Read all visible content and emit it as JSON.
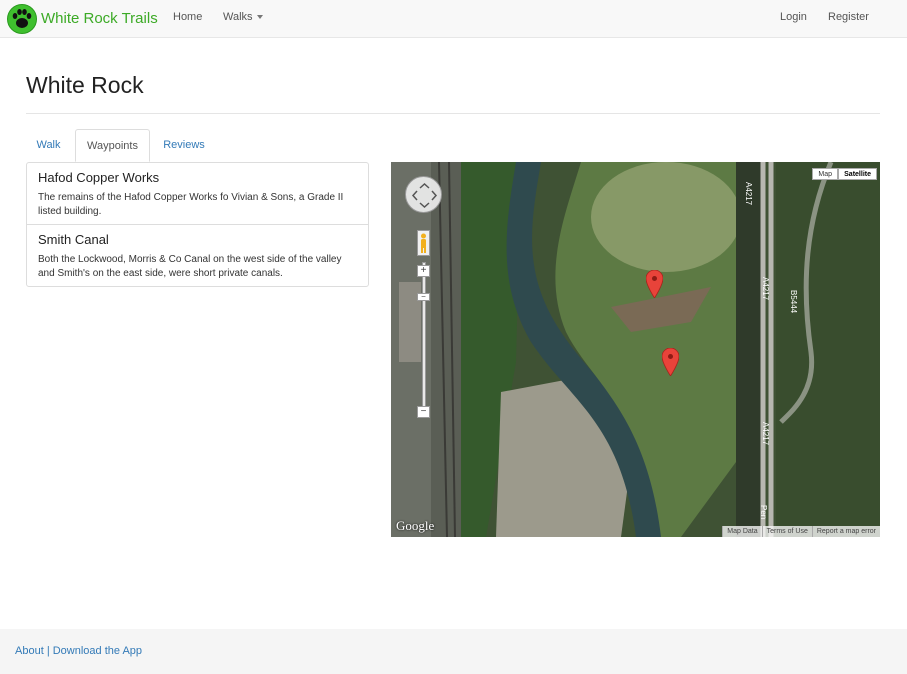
{
  "navbar": {
    "brand": "White Rock Trails",
    "logo_icon": "paw-print-icon",
    "home": "Home",
    "walks": "Walks",
    "login": "Login",
    "register": "Register"
  },
  "page": {
    "title": "White Rock"
  },
  "tabs": [
    {
      "label": "Walk"
    },
    {
      "label": "Waypoints",
      "active": true
    },
    {
      "label": "Reviews"
    }
  ],
  "waypoints": [
    {
      "title": "Hafod Copper Works",
      "description": "The remains of the Hafod Copper Works fo Vivian & Sons, a Grade II listed building."
    },
    {
      "title": "Smith Canal",
      "description": "Both the Lockwood, Morris & Co Canal on the west side of the valley and Smith's on the east side, were short private canals."
    }
  ],
  "map": {
    "type_map": "Map",
    "type_satellite": "Satellite",
    "logo": "Google",
    "map_data": "Map Data",
    "terms": "Terms of Use",
    "report": "Report a map error",
    "zoom_in": "+",
    "zoom_out": "−",
    "road_labels": [
      "A4217",
      "A4217",
      "A4217",
      "B5444",
      "Pen"
    ]
  },
  "footer": {
    "about": "About",
    "separator": "|",
    "download": "Download the App"
  },
  "colors": {
    "brand_green": "#3caa26",
    "link_blue": "#337ab7",
    "marker_red": "#e8433a"
  }
}
